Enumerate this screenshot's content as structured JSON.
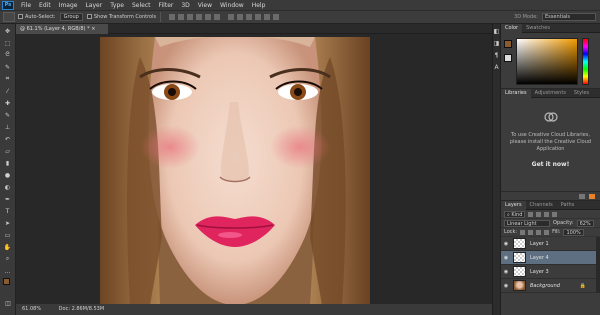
{
  "menu": {
    "logo": "Ps",
    "items": [
      "File",
      "Edit",
      "Image",
      "Layer",
      "Type",
      "Select",
      "Filter",
      "3D",
      "View",
      "Window",
      "Help"
    ]
  },
  "options": {
    "auto_select_label": "Auto-Select:",
    "auto_select_value": "Group",
    "show_transform_label": "Show Transform Controls",
    "mode_3d_label": "3D Mode:",
    "workspace": "Essentials"
  },
  "document": {
    "tab_title": "@ 61.1% (Layer 4, RGB/8) *"
  },
  "status": {
    "zoom": "61.08%",
    "doc": "Doc: 2.86M/8.53M"
  },
  "color_panel": {
    "tabs": [
      "Color",
      "Swatches"
    ],
    "fg_color": "#8a5a30",
    "bg_color": "#dcdcdc"
  },
  "libraries_panel": {
    "tabs": [
      "Libraries",
      "Adjustments",
      "Styles"
    ],
    "message": "To use Creative Cloud Libraries, please install the Creative Cloud Application",
    "cta": "Get it now!"
  },
  "layers_panel": {
    "tabs": [
      "Layers",
      "Channels",
      "Paths"
    ],
    "filter": "Kind",
    "blend_mode": "Linear Light",
    "opacity_label": "Opacity:",
    "opacity_value": "62%",
    "lock_label": "Lock:",
    "fill_label": "Fill:",
    "fill_value": "100%",
    "layers": [
      {
        "name": "Layer 1",
        "selected": false,
        "photo": false
      },
      {
        "name": "Layer 4",
        "selected": true,
        "photo": false
      },
      {
        "name": "Layer 3",
        "selected": false,
        "photo": false
      },
      {
        "name": "Background",
        "selected": false,
        "photo": true
      }
    ]
  },
  "tools": [
    "move-tool",
    "marquee-tool",
    "lasso-tool",
    "quick-select-tool",
    "crop-tool",
    "eyedropper-tool",
    "healing-brush-tool",
    "brush-tool",
    "clone-stamp-tool",
    "history-brush-tool",
    "eraser-tool",
    "gradient-tool",
    "blur-tool",
    "dodge-tool",
    "pen-tool",
    "type-tool",
    "path-select-tool",
    "rectangle-tool",
    "hand-tool",
    "zoom-tool",
    "more-tools"
  ]
}
